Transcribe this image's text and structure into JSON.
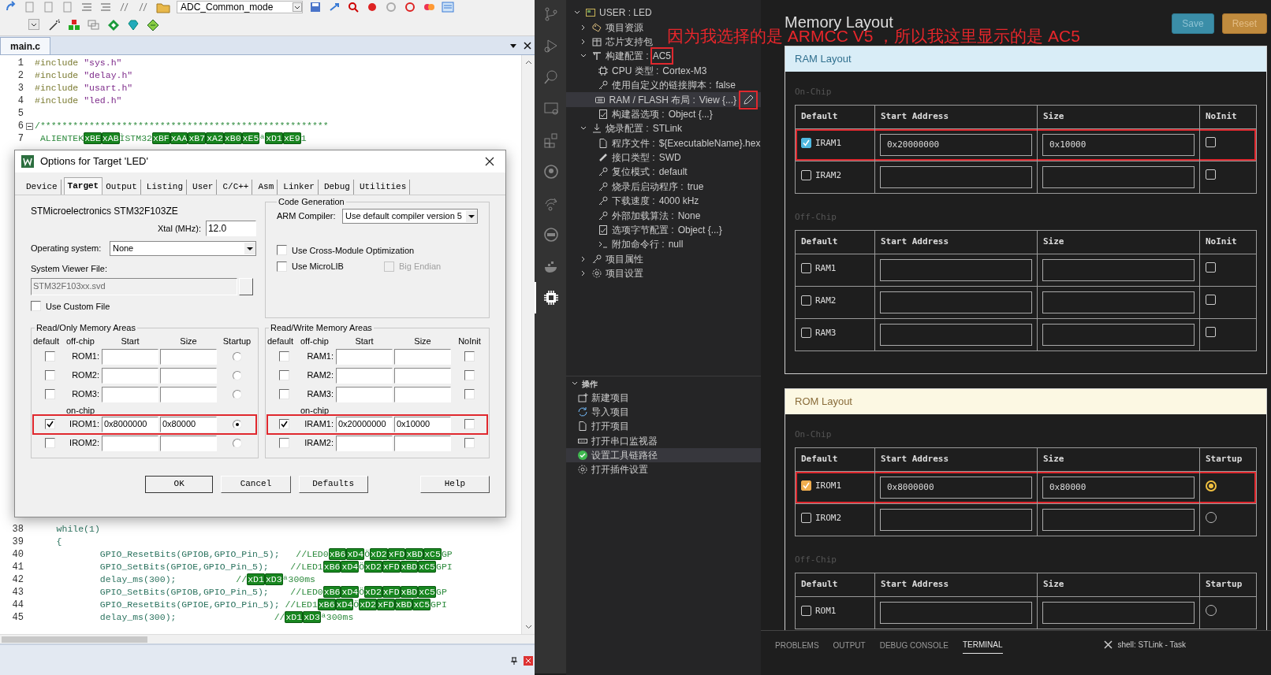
{
  "keil": {
    "toolbar": {
      "target": "ADC_Common_mode"
    },
    "tab": "main.c",
    "code_top": [
      {
        "number": "1",
        "collapsible": false,
        "tokens": [
          {
            "kind": "pp",
            "text": "#include "
          },
          {
            "kind": "str",
            "text": "\"sys.h\""
          }
        ]
      },
      {
        "number": "2",
        "collapsible": false,
        "tokens": [
          {
            "kind": "pp",
            "text": "#include "
          },
          {
            "kind": "str",
            "text": "\"delay.h\""
          }
        ]
      },
      {
        "number": "3",
        "collapsible": false,
        "tokens": [
          {
            "kind": "pp",
            "text": "#include "
          },
          {
            "kind": "str",
            "text": "\"usart.h\""
          }
        ]
      },
      {
        "number": "4",
        "collapsible": false,
        "tokens": [
          {
            "kind": "pp",
            "text": "#include "
          },
          {
            "kind": "str",
            "text": "\"led.h\""
          }
        ]
      },
      {
        "number": "5",
        "collapsible": false
      },
      {
        "number": "6",
        "collapsible": true,
        "tokens": [
          {
            "kind": "com",
            "text": "/*****************************************************"
          }
        ]
      },
      {
        "number": "7",
        "collapsible": false,
        "tokens": [
          {
            "kind": "com",
            "text": " ALIENTEK"
          },
          {
            "kind": "hex",
            "text": "xBE"
          },
          {
            "kind": "hex",
            "text": "xAB"
          },
          {
            "kind": "com",
            "text": "ÌSTM32"
          },
          {
            "kind": "hex",
            "text": "xBF"
          },
          {
            "kind": "hex",
            "text": "xAA"
          },
          {
            "kind": "hex",
            "text": "xB7"
          },
          {
            "kind": "hex",
            "text": "xA2"
          },
          {
            "kind": "hex",
            "text": "xB0"
          },
          {
            "kind": "hex",
            "text": "xE5"
          },
          {
            "kind": "com",
            "text": "ª"
          },
          {
            "kind": "hex",
            "text": "xD1"
          },
          {
            "kind": "hex",
            "text": "xE9"
          },
          {
            "kind": "com",
            "text": "1"
          }
        ]
      }
    ],
    "code_bottom": [
      {
        "number": "38",
        "collapsible": false,
        "tokens": [
          {
            "kind": "code",
            "text": "    while(1)"
          }
        ]
      },
      {
        "number": "39",
        "collapsible": false,
        "tokens": [
          {
            "kind": "code",
            "text": "    {"
          }
        ]
      },
      {
        "number": "40",
        "collapsible": false,
        "tokens": [
          {
            "kind": "code",
            "text": "            GPIO_ResetBits(GPIOB,GPIO_Pin_5);"
          },
          {
            "kind": "com",
            "text": "   //LED0"
          },
          {
            "kind": "hex",
            "text": "xB6"
          },
          {
            "kind": "hex",
            "text": "xD4"
          },
          {
            "kind": "com",
            "text": "Ö"
          },
          {
            "kind": "hex",
            "text": "xD2"
          },
          {
            "kind": "hex",
            "text": "xFD"
          },
          {
            "kind": "hex",
            "text": "xBD"
          },
          {
            "kind": "hex",
            "text": "xC5"
          },
          {
            "kind": "com",
            "text": "GP"
          }
        ]
      },
      {
        "number": "41",
        "collapsible": false,
        "tokens": [
          {
            "kind": "code",
            "text": "            GPIO_SetBits(GPIOE,GPIO_Pin_5);"
          },
          {
            "kind": "com",
            "text": "    //LED1"
          },
          {
            "kind": "hex",
            "text": "xB6"
          },
          {
            "kind": "hex",
            "text": "xD4"
          },
          {
            "kind": "com",
            "text": "Ö"
          },
          {
            "kind": "hex",
            "text": "xD2"
          },
          {
            "kind": "hex",
            "text": "xFD"
          },
          {
            "kind": "hex",
            "text": "xBD"
          },
          {
            "kind": "hex",
            "text": "xC5"
          },
          {
            "kind": "com",
            "text": "GPI"
          }
        ]
      },
      {
        "number": "42",
        "collapsible": false,
        "tokens": [
          {
            "kind": "code",
            "text": "            delay_ms(300);"
          },
          {
            "kind": "com",
            "text": "           //"
          },
          {
            "kind": "hex",
            "text": "xD1"
          },
          {
            "kind": "hex",
            "text": "xD3"
          },
          {
            "kind": "com",
            "text": "ª300ms"
          }
        ]
      },
      {
        "number": "43",
        "collapsible": false,
        "tokens": [
          {
            "kind": "code",
            "text": "            GPIO_SetBits(GPIOB,GPIO_Pin_5);"
          },
          {
            "kind": "com",
            "text": "    //LED0"
          },
          {
            "kind": "hex",
            "text": "xB6"
          },
          {
            "kind": "hex",
            "text": "xD4"
          },
          {
            "kind": "com",
            "text": "Ö"
          },
          {
            "kind": "hex",
            "text": "xD2"
          },
          {
            "kind": "hex",
            "text": "xFD"
          },
          {
            "kind": "hex",
            "text": "xBD"
          },
          {
            "kind": "hex",
            "text": "xC5"
          },
          {
            "kind": "com",
            "text": "GP"
          }
        ]
      },
      {
        "number": "44",
        "collapsible": false,
        "tokens": [
          {
            "kind": "code",
            "text": "            GPIO_ResetBits(GPIOE,GPIO_Pin_5);"
          },
          {
            "kind": "com",
            "text": " //LED1"
          },
          {
            "kind": "hex",
            "text": "xB6"
          },
          {
            "kind": "hex",
            "text": "xD4"
          },
          {
            "kind": "com",
            "text": "Ö"
          },
          {
            "kind": "hex",
            "text": "xD2"
          },
          {
            "kind": "hex",
            "text": "xFD"
          },
          {
            "kind": "hex",
            "text": "xBD"
          },
          {
            "kind": "hex",
            "text": "xC5"
          },
          {
            "kind": "com",
            "text": "GPI"
          }
        ]
      },
      {
        "number": "45",
        "collapsible": false,
        "tokens": [
          {
            "kind": "code",
            "text": "            delay_ms(300);"
          },
          {
            "kind": "com",
            "text": "                  //"
          },
          {
            "kind": "hex",
            "text": "xD1"
          },
          {
            "kind": "hex",
            "text": "xD3"
          },
          {
            "kind": "com",
            "text": "ª300ms"
          }
        ]
      }
    ],
    "dialog": {
      "title": "Options for Target 'LED'",
      "tabs": [
        {
          "label": "Device",
          "selected": false
        },
        {
          "label": "Target",
          "selected": true
        },
        {
          "label": "Output",
          "selected": false
        },
        {
          "label": "Listing",
          "selected": false
        },
        {
          "label": "User",
          "selected": false
        },
        {
          "label": "C/C++",
          "selected": false
        },
        {
          "label": "Asm",
          "selected": false
        },
        {
          "label": "Linker",
          "selected": false
        },
        {
          "label": "Debug",
          "selected": false
        },
        {
          "label": "Utilities",
          "selected": false
        }
      ],
      "device": "STMicroelectronics STM32F103ZE",
      "xtal": {
        "label": "Xtal (MHz):",
        "value": "12.0"
      },
      "os": {
        "label": "Operating system:",
        "value": "None"
      },
      "svd": {
        "label": "System Viewer File:",
        "value": "STM32F103xx.svd",
        "disabled": true
      },
      "custom_file": {
        "label": "Use Custom File",
        "checked": false
      },
      "code_generation": {
        "title": "Code Generation",
        "compiler_label": "ARM Compiler:",
        "compiler": "Use default compiler version 5",
        "options": [
          {
            "label": "Use Cross-Module Optimization",
            "checked": false,
            "disabled": false
          },
          {
            "label": "Use MicroLIB",
            "checked": false,
            "disabled": false
          },
          {
            "label": "Big Endian",
            "checked": false,
            "disabled": true
          }
        ]
      },
      "memory": [
        {
          "title": "Read/Only Memory Areas",
          "kind": "radio",
          "columns": [
            "default",
            "off-chip",
            "Start",
            "Size",
            "Startup"
          ],
          "off_chip": [
            {
              "label": "ROM1:",
              "default": false,
              "flag": false,
              "boxed": false
            },
            {
              "label": "ROM2:",
              "default": false,
              "flag": false,
              "boxed": false
            },
            {
              "label": "ROM3:",
              "default": false,
              "flag": false,
              "boxed": false
            }
          ],
          "on_chip_label": "on-chip",
          "on_chip": [
            {
              "label": "IROM1:",
              "default": true,
              "start": "0x8000000",
              "size": "0x80000",
              "flag": true,
              "boxed": true
            },
            {
              "label": "IROM2:",
              "default": false,
              "flag": false,
              "boxed": false
            }
          ]
        },
        {
          "title": "Read/Write Memory Areas",
          "kind": "checkbox",
          "columns": [
            "default",
            "off-chip",
            "Start",
            "Size",
            "NoInit"
          ],
          "off_chip": [
            {
              "label": "RAM1:",
              "default": false,
              "flag": false,
              "boxed": false
            },
            {
              "label": "RAM2:",
              "default": false,
              "flag": false,
              "boxed": false
            },
            {
              "label": "RAM3:",
              "default": false,
              "flag": false,
              "boxed": false
            }
          ],
          "on_chip_label": "on-chip",
          "on_chip": [
            {
              "label": "IRAM1:",
              "default": true,
              "start": "0x20000000",
              "size": "0x10000",
              "flag": false,
              "boxed": true
            },
            {
              "label": "IRAM2:",
              "default": false,
              "flag": false,
              "boxed": false
            }
          ]
        }
      ],
      "buttons": [
        "OK",
        "Cancel",
        "Defaults",
        "Help"
      ]
    }
  },
  "activity_bar": [
    {
      "kind": "branch",
      "selected": false
    },
    {
      "kind": "run",
      "selected": false
    },
    {
      "kind": "search",
      "selected": false
    },
    {
      "kind": "monitor",
      "selected": false
    },
    {
      "kind": "blocks",
      "selected": false
    },
    {
      "kind": "circle",
      "selected": false
    },
    {
      "kind": "share",
      "selected": false
    },
    {
      "kind": "disc",
      "selected": false
    },
    {
      "kind": "whale",
      "selected": false
    },
    {
      "kind": "chip",
      "selected": true
    }
  ],
  "project_tree": [
    {
      "label": "USER : LED",
      "kind": "project",
      "expanded": true,
      "selected": false,
      "children": [
        {
          "label": "项目资源",
          "kind": "folder",
          "expanded": false,
          "selected": false
        },
        {
          "label": "芯片支持包",
          "kind": "package",
          "expanded": false,
          "selected": false
        },
        {
          "label": "构建配置 :",
          "value": "AC5",
          "boxed": true,
          "kind": "config",
          "expanded": true,
          "selected": false,
          "children": [
            {
              "label": "CPU 类型 :",
              "value": "Cortex-M3",
              "kind": "cpu",
              "selected": false
            },
            {
              "label": "使用自定义的链接脚本 :",
              "value": "false",
              "kind": "key",
              "selected": false
            },
            {
              "label": "RAM / FLASH 布局 :",
              "value": "View {...}",
              "kind": "layout",
              "selected": true,
              "boxed": true
            },
            {
              "label": "构建器选项 :",
              "value": "Object {...}",
              "kind": "options",
              "selected": false
            }
          ]
        },
        {
          "label": "烧录配置 :",
          "value": "STLink",
          "kind": "download",
          "expanded": true,
          "selected": false,
          "children": [
            {
              "label": "程序文件 :",
              "value": "${ExecutableName}.hex",
              "kind": "file",
              "selected": false
            },
            {
              "label": "接口类型 :",
              "value": "SWD",
              "kind": "interface",
              "selected": false
            },
            {
              "label": "复位模式 :",
              "value": "default",
              "kind": "key",
              "selected": false
            },
            {
              "label": "烧录后启动程序 :",
              "value": "true",
              "kind": "key",
              "selected": false
            },
            {
              "label": "下载速度 :",
              "value": "4000 kHz",
              "kind": "key",
              "selected": false
            },
            {
              "label": "外部加载算法 :",
              "value": "None",
              "kind": "key",
              "selected": false
            },
            {
              "label": "选项字节配置 :",
              "value": "Object {...}",
              "kind": "options",
              "selected": false
            },
            {
              "label": "附加命令行 :",
              "value": "null",
              "kind": "terminal",
              "selected": false
            }
          ]
        },
        {
          "label": "项目属性",
          "kind": "key",
          "expanded": false,
          "selected": false
        },
        {
          "label": "项目设置",
          "kind": "settings",
          "expanded": false,
          "selected": false
        }
      ]
    }
  ],
  "actions": {
    "title": "操作",
    "expanded": true,
    "items": [
      {
        "label": "新建项目",
        "kind": "new",
        "selected": false
      },
      {
        "label": "导入项目",
        "kind": "import",
        "selected": false
      },
      {
        "label": "打开项目",
        "kind": "open",
        "selected": false
      },
      {
        "label": "打开串口监视器",
        "kind": "monitor",
        "selected": false
      },
      {
        "label": "设置工具链路径",
        "kind": "check",
        "selected": true
      },
      {
        "label": "打开插件设置",
        "kind": "settings",
        "selected": false
      }
    ]
  },
  "memory_layout": {
    "title": "Memory Layout",
    "buttons": [
      {
        "label": "Save",
        "kind": "primary"
      },
      {
        "label": "Reset",
        "kind": "warning"
      }
    ],
    "panels": [
      {
        "title": "RAM Layout",
        "kind": "ram",
        "sections": [
          {
            "label": "On-Chip",
            "columns": [
              "Default",
              "Start Address",
              "Size",
              "NoInit"
            ],
            "rows": [
              {
                "name": "IRAM1",
                "default": true,
                "start": "0x20000000",
                "size": "0x10000",
                "flag": false,
                "boxed": true
              },
              {
                "name": "IRAM2",
                "default": false,
                "flag": false,
                "boxed": false
              }
            ]
          },
          {
            "label": "Off-Chip",
            "columns": [
              "Default",
              "Start Address",
              "Size",
              "NoInit"
            ],
            "rows": [
              {
                "name": "RAM1",
                "default": false,
                "flag": false,
                "boxed": false
              },
              {
                "name": "RAM2",
                "default": false,
                "flag": false,
                "boxed": false
              },
              {
                "name": "RAM3",
                "default": false,
                "flag": false,
                "boxed": false
              }
            ]
          }
        ]
      },
      {
        "title": "ROM Layout",
        "kind": "rom",
        "sections": [
          {
            "label": "On-Chip",
            "columns": [
              "Default",
              "Start Address",
              "Size",
              "Startup"
            ],
            "rows": [
              {
                "name": "IROM1",
                "default": true,
                "start": "0x8000000",
                "size": "0x80000",
                "flag": true,
                "boxed": true
              },
              {
                "name": "IROM2",
                "default": false,
                "flag": false,
                "boxed": false
              }
            ]
          },
          {
            "label": "Off-Chip",
            "columns": [
              "Default",
              "Start Address",
              "Size",
              "Startup"
            ],
            "rows": [
              {
                "name": "ROM1",
                "default": false,
                "flag": false,
                "boxed": false
              }
            ]
          }
        ]
      }
    ]
  },
  "panel": {
    "tabs": [
      {
        "label": "PROBLEMS",
        "selected": false
      },
      {
        "label": "OUTPUT",
        "selected": false
      },
      {
        "label": "DEBUG CONSOLE",
        "selected": false
      },
      {
        "label": "TERMINAL",
        "selected": true
      }
    ],
    "terminal": "shell: STLink - Task"
  },
  "annotation": "因为我选择的是 ARMCC V5 ，所以我这里显示的是 AC5"
}
